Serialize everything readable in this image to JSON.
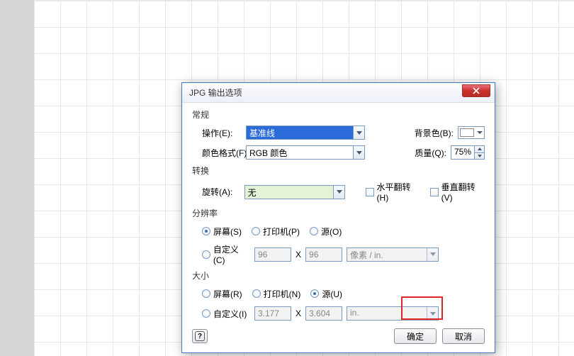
{
  "dialog": {
    "title": "JPG 输出选项",
    "close_icon": "close"
  },
  "general": {
    "legend": "常规",
    "operation_label": "操作(E):",
    "operation_value": "基准线",
    "colorformat_label": "颜色格式(F):",
    "colorformat_value": "RGB 颜色",
    "bgcolor_label": "背景色(B):",
    "bgcolor_value": "#ffffff",
    "quality_label": "质量(Q):",
    "quality_value": "75%"
  },
  "transform": {
    "legend": "转换",
    "rotate_label": "旋转(A):",
    "rotate_value": "无",
    "hflip_label": "水平翻转(H)",
    "vflip_label": "垂直翻转(V)",
    "hflip": false,
    "vflip": false
  },
  "resolution": {
    "legend": "分辨率",
    "screen_label": "屏幕(S)",
    "printer_label": "打印机(P)",
    "source_label": "源(O)",
    "custom_label": "自定义(C)",
    "choice": "screen",
    "x_value": "96",
    "y_value": "96",
    "x_sep": "X",
    "unit_value": "像素 / in."
  },
  "size": {
    "legend": "大小",
    "screen_label": "屏幕(R)",
    "printer_label": "打印机(N)",
    "source_label": "源(U)",
    "custom_label": "自定义(I)",
    "choice": "source",
    "x_value": "3.177",
    "y_value": "3.604",
    "x_sep": "X",
    "unit_value": "in."
  },
  "buttons": {
    "help": "?",
    "ok": "确定",
    "cancel": "取消"
  }
}
